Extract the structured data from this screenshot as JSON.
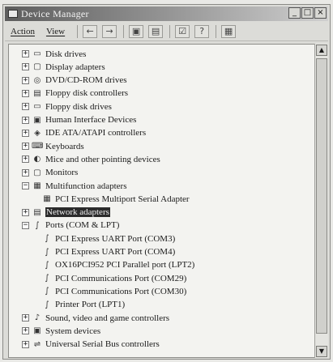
{
  "window": {
    "title": "Device Manager",
    "minimize": "_",
    "restore": "□",
    "close": "×"
  },
  "menu": {
    "action": "Action",
    "view": "View"
  },
  "toolbar": {
    "back": "←",
    "forward": "→",
    "b3": "▣",
    "b4": "▤",
    "b5": "☑",
    "b6": "?",
    "b7": "▦"
  },
  "tree": [
    {
      "label": "Disk drives",
      "toggle": "+",
      "icon": "▭"
    },
    {
      "label": "Display adapters",
      "toggle": "+",
      "icon": "▢"
    },
    {
      "label": "DVD/CD-ROM drives",
      "toggle": "+",
      "icon": "◎"
    },
    {
      "label": "Floppy disk controllers",
      "toggle": "+",
      "icon": "▤"
    },
    {
      "label": "Floppy disk drives",
      "toggle": "+",
      "icon": "▭"
    },
    {
      "label": "Human Interface Devices",
      "toggle": "+",
      "icon": "▣"
    },
    {
      "label": "IDE ATA/ATAPI controllers",
      "toggle": "+",
      "icon": "◈"
    },
    {
      "label": "Keyboards",
      "toggle": "+",
      "icon": "⌨"
    },
    {
      "label": "Mice and other pointing devices",
      "toggle": "+",
      "icon": "◐"
    },
    {
      "label": "Monitors",
      "toggle": "+",
      "icon": "▢"
    },
    {
      "label": "Multifunction adapters",
      "toggle": "−",
      "icon": "▦"
    },
    {
      "label": "PCI Express Multiport Serial Adapter",
      "toggle": "",
      "icon": "▦"
    },
    {
      "label": "Network adapters",
      "toggle": "+",
      "icon": "▤"
    },
    {
      "label": "Ports (COM & LPT)",
      "toggle": "−",
      "icon": "∫"
    },
    {
      "label": "PCI Express UART Port (COM3)",
      "toggle": "",
      "icon": "∫"
    },
    {
      "label": "PCI Express UART Port (COM4)",
      "toggle": "",
      "icon": "∫"
    },
    {
      "label": "OX16PCI952 PCI Parallel port (LPT2)",
      "toggle": "",
      "icon": "∫"
    },
    {
      "label": "PCI Communications Port (COM29)",
      "toggle": "",
      "icon": "∫"
    },
    {
      "label": "PCI Communications Port (COM30)",
      "toggle": "",
      "icon": "∫"
    },
    {
      "label": "Printer Port (LPT1)",
      "toggle": "",
      "icon": "∫"
    },
    {
      "label": "Sound, video and game controllers",
      "toggle": "+",
      "icon": "♪"
    },
    {
      "label": "System devices",
      "toggle": "+",
      "icon": "▣"
    },
    {
      "label": "Universal Serial Bus controllers",
      "toggle": "+",
      "icon": "⇌"
    }
  ],
  "scroll": {
    "up": "▲",
    "down": "▼"
  }
}
